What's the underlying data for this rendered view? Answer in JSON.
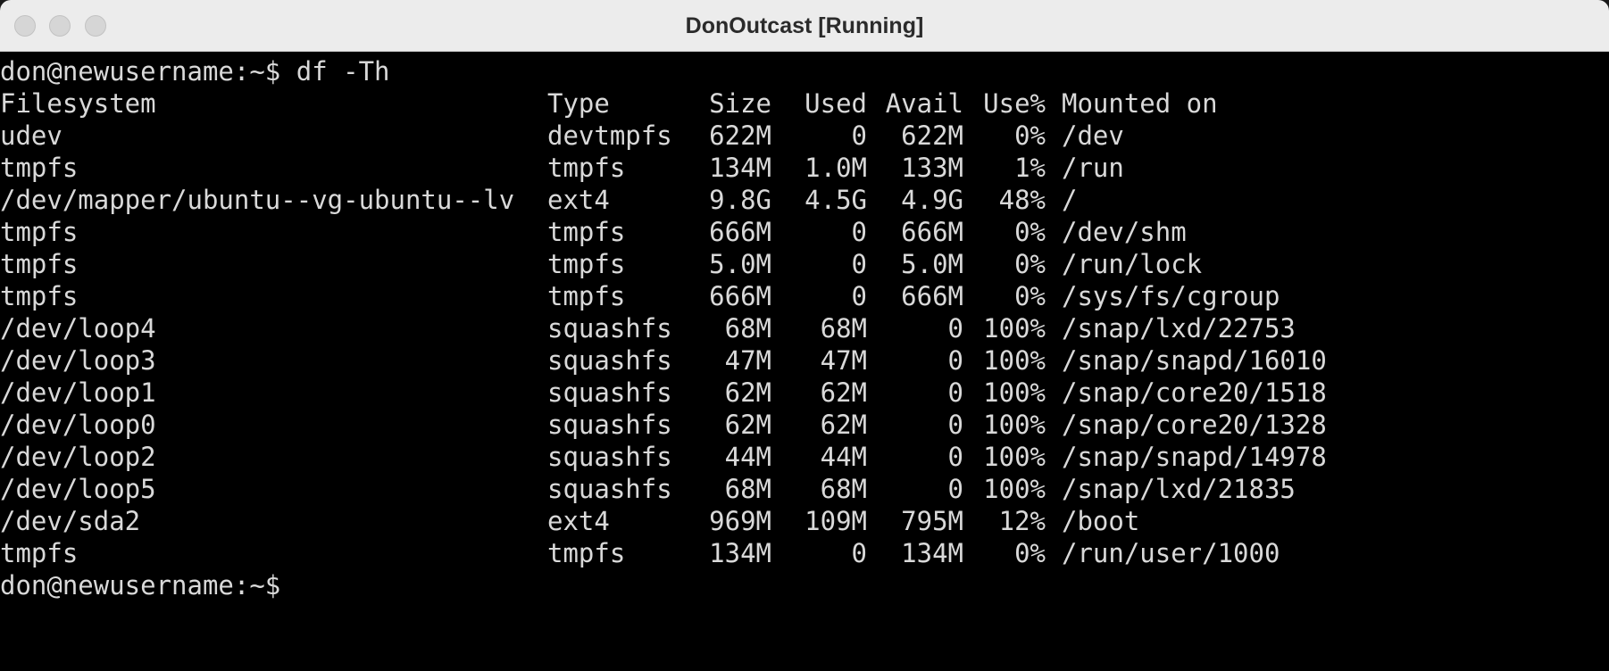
{
  "window": {
    "title": "DonOutcast [Running]"
  },
  "terminal": {
    "command_line": "don@newusername:~$ df -Th",
    "header": {
      "filesystem": "Filesystem",
      "type": "Type",
      "size": "Size",
      "used": "Used",
      "avail": "Avail",
      "use_pct": "Use%",
      "mounted": "Mounted on"
    },
    "rows": [
      {
        "filesystem": "udev",
        "type": "devtmpfs",
        "size": "622M",
        "used": "0",
        "avail": "622M",
        "use_pct": "0%",
        "mounted": "/dev"
      },
      {
        "filesystem": "tmpfs",
        "type": "tmpfs",
        "size": "134M",
        "used": "1.0M",
        "avail": "133M",
        "use_pct": "1%",
        "mounted": "/run"
      },
      {
        "filesystem": "/dev/mapper/ubuntu--vg-ubuntu--lv",
        "type": "ext4",
        "size": "9.8G",
        "used": "4.5G",
        "avail": "4.9G",
        "use_pct": "48%",
        "mounted": "/"
      },
      {
        "filesystem": "tmpfs",
        "type": "tmpfs",
        "size": "666M",
        "used": "0",
        "avail": "666M",
        "use_pct": "0%",
        "mounted": "/dev/shm"
      },
      {
        "filesystem": "tmpfs",
        "type": "tmpfs",
        "size": "5.0M",
        "used": "0",
        "avail": "5.0M",
        "use_pct": "0%",
        "mounted": "/run/lock"
      },
      {
        "filesystem": "tmpfs",
        "type": "tmpfs",
        "size": "666M",
        "used": "0",
        "avail": "666M",
        "use_pct": "0%",
        "mounted": "/sys/fs/cgroup"
      },
      {
        "filesystem": "/dev/loop4",
        "type": "squashfs",
        "size": "68M",
        "used": "68M",
        "avail": "0",
        "use_pct": "100%",
        "mounted": "/snap/lxd/22753"
      },
      {
        "filesystem": "/dev/loop3",
        "type": "squashfs",
        "size": "47M",
        "used": "47M",
        "avail": "0",
        "use_pct": "100%",
        "mounted": "/snap/snapd/16010"
      },
      {
        "filesystem": "/dev/loop1",
        "type": "squashfs",
        "size": "62M",
        "used": "62M",
        "avail": "0",
        "use_pct": "100%",
        "mounted": "/snap/core20/1518"
      },
      {
        "filesystem": "/dev/loop0",
        "type": "squashfs",
        "size": "62M",
        "used": "62M",
        "avail": "0",
        "use_pct": "100%",
        "mounted": "/snap/core20/1328"
      },
      {
        "filesystem": "/dev/loop2",
        "type": "squashfs",
        "size": "44M",
        "used": "44M",
        "avail": "0",
        "use_pct": "100%",
        "mounted": "/snap/snapd/14978"
      },
      {
        "filesystem": "/dev/loop5",
        "type": "squashfs",
        "size": "68M",
        "used": "68M",
        "avail": "0",
        "use_pct": "100%",
        "mounted": "/snap/lxd/21835"
      },
      {
        "filesystem": "/dev/sda2",
        "type": "ext4",
        "size": "969M",
        "used": "109M",
        "avail": "795M",
        "use_pct": "12%",
        "mounted": "/boot"
      },
      {
        "filesystem": "tmpfs",
        "type": "tmpfs",
        "size": "134M",
        "used": "0",
        "avail": "134M",
        "use_pct": "0%",
        "mounted": "/run/user/1000"
      }
    ],
    "final_prompt": "don@newusername:~$"
  }
}
